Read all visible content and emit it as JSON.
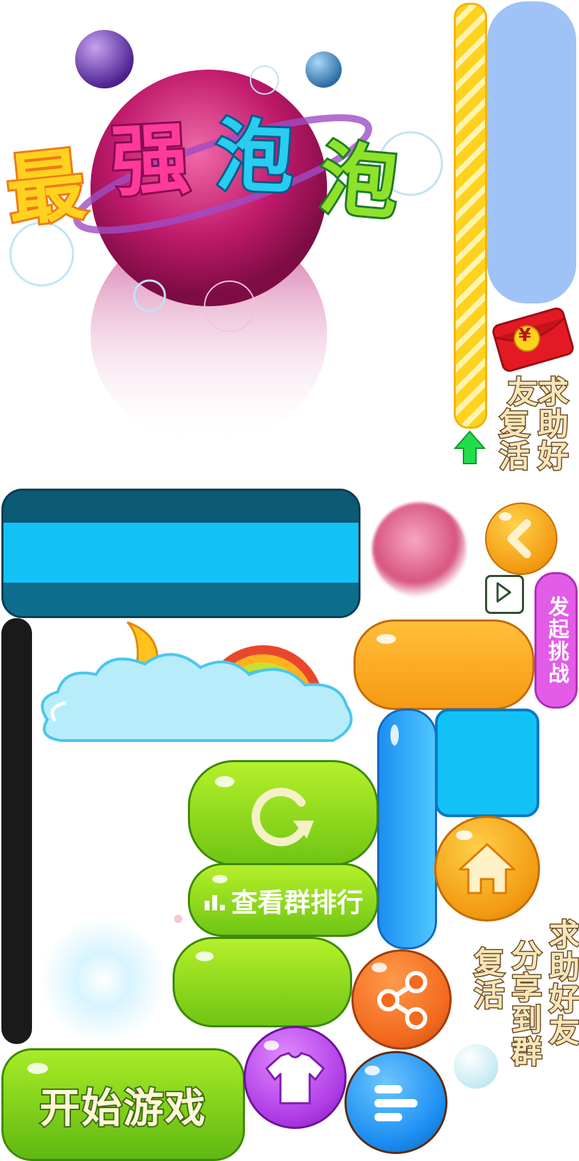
{
  "title": {
    "chars": [
      "最",
      "强",
      "泡",
      "泡"
    ]
  },
  "side_labels": {
    "invite_revive": [
      "求助好友",
      "复活"
    ],
    "share_revive": [
      "求助好友",
      "分享到群",
      "复活"
    ]
  },
  "buttons": {
    "rank_label": "查看群排行",
    "start_label": "开始游戏",
    "challenge_label": "发起挑战"
  },
  "icons": {
    "red_envelope": "red-envelope-icon",
    "yuan_symbol": "¥",
    "up_arrow": "up-arrow-icon",
    "back": "chevron-left-icon",
    "play": "play-icon",
    "restart": "restart-icon",
    "rank": "bar-chart-icon",
    "home": "home-icon",
    "share": "share-icon",
    "skin": "tshirt-icon",
    "menu": "menu-icon"
  },
  "colors": {
    "bar_blue": "#9fc3f7",
    "cyan": "#12c2f7",
    "dark_teal": "#0b5a76",
    "green": "#7cd41a",
    "orange": "#f9a21c",
    "purple": "#b13de6",
    "pink_pill": "#e35ce8",
    "share_orange": "#f26a1f",
    "menu_blue": "#1c8ef2"
  }
}
